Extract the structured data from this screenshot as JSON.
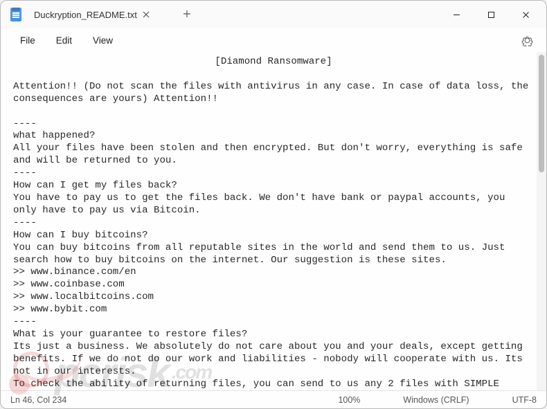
{
  "window": {
    "title": "Duckryption_README.txt"
  },
  "menus": {
    "file": "File",
    "edit": "Edit",
    "view": "View"
  },
  "document": {
    "header": "[Diamond Ransomware]",
    "para1": "Attention!! (Do not scan the files with antivirus in any case. In case of data loss, the consequences are yours) Attention!!",
    "sep1": "----",
    "q1": "what happened?",
    "a1": "All your files have been stolen and then encrypted. But don't worry, everything is safe and will be returned to you.",
    "sep2": "----",
    "q2": "How can I get my files back?",
    "a2": "You have to pay us to get the files back. We don't have bank or paypal accounts, you only have to pay us via Bitcoin.",
    "sep3": "----",
    "q3": "How can I buy bitcoins?",
    "a3": "You can buy bitcoins from all reputable sites in the world and send them to us. Just search how to buy bitcoins on the internet. Our suggestion is these sites.",
    "site1": ">> www.binance.com/en",
    "site2": ">> www.coinbase.com",
    "site3": ">> www.localbitcoins.com",
    "site4": ">> www.bybit.com",
    "sep4": "----",
    "q4": "What is your guarantee to restore files?",
    "a4a": "Its just a business. We absolutely do not care about you and your deals, except getting benefits. If we do not do our work and liabilities - nobody will cooperate with us. Its not in our interests.",
    "a4b": "To check the ability of returning files, you can send to us any 2 files with SIMPLE extensions(jpg,xls,doc, etc... not databases!) and low sizes(max 1 mb), we will decrypt them and"
  },
  "status": {
    "position": "Ln 46, Col 234",
    "zoom": "100%",
    "encoding": "Windows (CRLF)",
    "charset": "UTF-8"
  },
  "watermark": {
    "brand": "pcrisk",
    "tld": ".com"
  }
}
